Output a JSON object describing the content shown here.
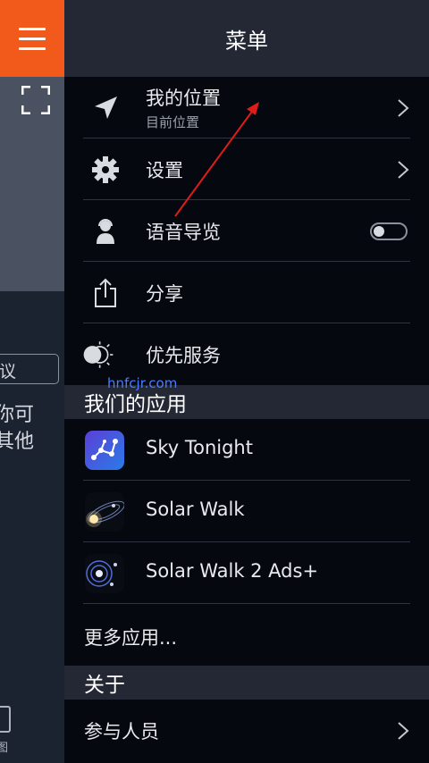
{
  "left_panel": {
    "hamburger_icon": "hamburger-menu-icon",
    "fullscreen_icon": "fullscreen-icon",
    "input_text": "议",
    "text_line1": "你可",
    "text_line2": "其他",
    "bottom_label": "图"
  },
  "menu": {
    "title": "菜单",
    "items": [
      {
        "label": "我的位置",
        "sub": "目前位置",
        "icon": "location-arrow-icon"
      },
      {
        "label": "设置",
        "icon": "gear-icon"
      },
      {
        "label": "语音导览",
        "icon": "audio-guide-icon"
      },
      {
        "label": "分享",
        "icon": "share-icon"
      },
      {
        "label": "优先服务",
        "icon": "day-night-icon"
      }
    ]
  },
  "apps_section": {
    "title": "我们的应用",
    "apps": [
      {
        "name": "Sky Tonight"
      },
      {
        "name": "Solar Walk"
      },
      {
        "name": "Solar Walk 2 Ads+"
      }
    ],
    "more": "更多应用..."
  },
  "about_section": {
    "title": "关于",
    "credits": "参与人员"
  },
  "watermark": "hnfcjr.com",
  "colors": {
    "accent": "#f25a1b",
    "arrow": "#e01b1b"
  }
}
